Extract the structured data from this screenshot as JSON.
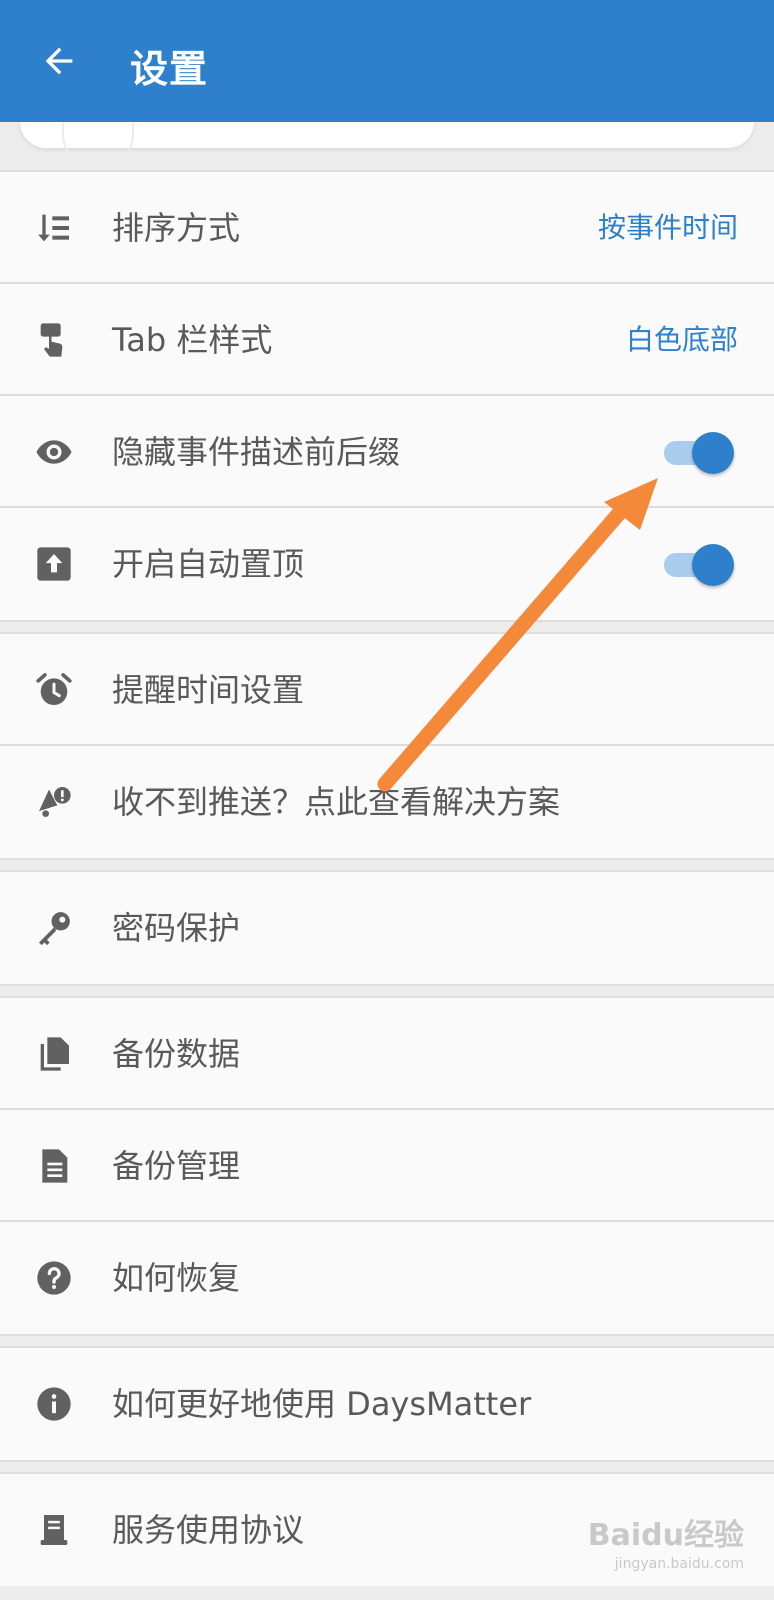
{
  "header": {
    "title": "设置",
    "back_icon": "arrow-left-icon"
  },
  "colors": {
    "accent": "#2f80cc",
    "annotation_arrow": "#f5893a",
    "label_text": "#595959"
  },
  "settings": {
    "sort": {
      "label": "排序方式",
      "value": "按事件时间",
      "icon": "sort-list-icon"
    },
    "tab_style": {
      "label": "Tab 栏样式",
      "value": "白色底部",
      "icon": "touch-hand-icon"
    },
    "hide_affix": {
      "label": "隐藏事件描述前后缀",
      "toggle_on": true,
      "icon": "eye-icon"
    },
    "auto_pin": {
      "label": "开启自动置顶",
      "toggle_on": true,
      "icon": "pin-top-icon"
    },
    "reminder_time": {
      "label": "提醒时间设置",
      "icon": "alarm-clock-icon"
    },
    "push_help": {
      "label": "收不到推送？点此查看解决方案",
      "icon": "bell-alert-icon"
    },
    "password": {
      "label": "密码保护",
      "icon": "key-icon"
    },
    "backup_data": {
      "label": "备份数据",
      "icon": "copy-files-icon"
    },
    "backup_manage": {
      "label": "备份管理",
      "icon": "document-icon"
    },
    "how_restore": {
      "label": "如何恢复",
      "icon": "help-circle-icon"
    },
    "how_use": {
      "label": "如何更好地使用 DaysMatter",
      "icon": "info-circle-icon"
    },
    "service_terms": {
      "label": "服务使用协议",
      "icon": "agreement-icon"
    }
  },
  "watermark": {
    "main": "Baidu经验",
    "sub": "jingyan.baidu.com"
  }
}
